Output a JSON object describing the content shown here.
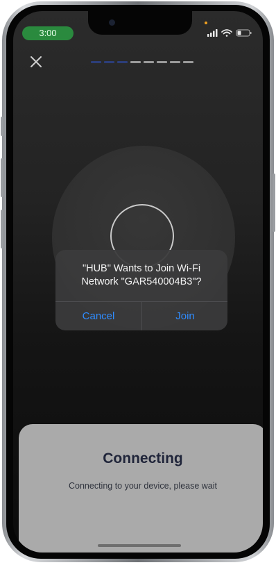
{
  "status_bar": {
    "time": "3:00",
    "time_pill_color": "#2a8a3e",
    "icons": [
      "cellular-icon",
      "wifi-icon",
      "battery-icon"
    ]
  },
  "nav": {
    "close_icon": "close-icon",
    "progress": {
      "total_steps": 8,
      "completed_steps": 3,
      "active_color": "#2c3e7a",
      "inactive_color": "#9a9a9a"
    }
  },
  "alert": {
    "title_line1": "\"HUB\" Wants to Join Wi-Fi",
    "title_line2": "Network \"GAR540004B3\"?",
    "cancel_label": "Cancel",
    "join_label": "Join",
    "button_color": "#2f8cff"
  },
  "sheet": {
    "title": "Connecting",
    "subtitle": "Connecting to your device, please wait"
  }
}
